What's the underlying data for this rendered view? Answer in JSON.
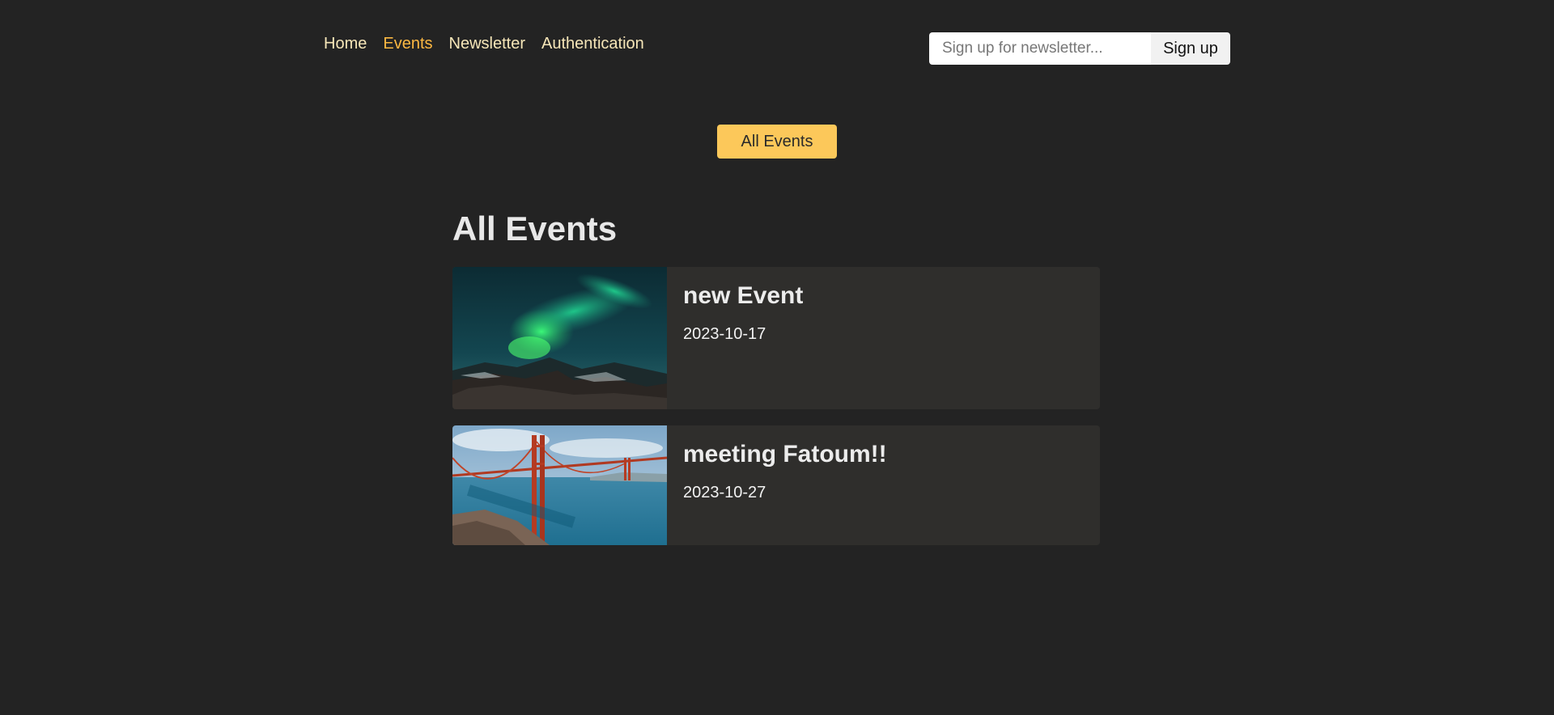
{
  "nav": {
    "items": [
      {
        "label": "Home",
        "active": false
      },
      {
        "label": "Events",
        "active": true
      },
      {
        "label": "Newsletter",
        "active": false
      },
      {
        "label": "Authentication",
        "active": false
      }
    ]
  },
  "newsletter": {
    "placeholder": "Sign up for newsletter...",
    "button_label": "Sign up"
  },
  "filter": {
    "button_label": "All Events"
  },
  "events_section": {
    "title": "All Events",
    "events": [
      {
        "title": "new Event",
        "date": "2023-10-17",
        "image": "aurora-landscape"
      },
      {
        "title": "meeting Fatoum!!",
        "date": "2023-10-27",
        "image": "golden-gate-bridge"
      }
    ]
  },
  "colors": {
    "background": "#232323",
    "nav_text": "#f6e6b8",
    "nav_active": "#fcb842",
    "accent_button": "#fcc85a",
    "card_background": "#2f2e2c"
  }
}
